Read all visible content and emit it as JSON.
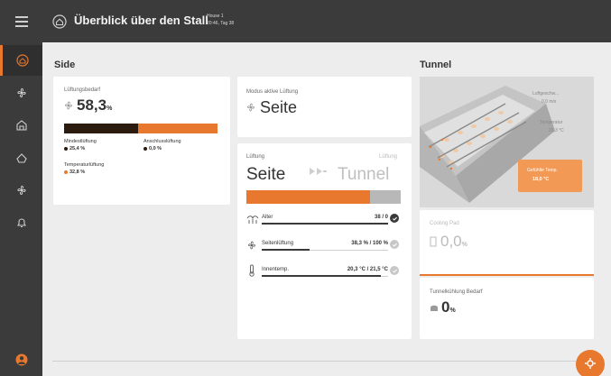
{
  "header": {
    "title": "Überblick über den Stall",
    "house_name": "House 1",
    "house_info": "20:46, Tag 38"
  },
  "sections": {
    "side": "Side",
    "tunnel": "Tunnel"
  },
  "ventilation_need": {
    "label": "Lüftungsbedarf",
    "value": "58,3",
    "unit": "%",
    "bar_dark_fraction": 0.48,
    "items": [
      {
        "label": "Mindestlüftung",
        "value": "25,4 %",
        "color": "#2b1a0e"
      },
      {
        "label": "Anschlusslüftung",
        "value": "0,0 %",
        "color": "#2b1a0e"
      },
      {
        "label": "Temperaturlüftung",
        "value": "32,8 %",
        "color": "#e8782d"
      }
    ]
  },
  "active_mode": {
    "label": "Modus aktive Lüftung",
    "value": "Seite"
  },
  "ventilation_switch": {
    "left_label": "Lüftung",
    "left_value": "Seite",
    "right_label": "Lüftung",
    "right_value": "Tunnel",
    "progress_fraction": 0.8,
    "rows": [
      {
        "icon": "age-icon",
        "label": "Alter",
        "value": "38 / 0",
        "fill": 1.0,
        "done": true
      },
      {
        "icon": "side-fan-icon",
        "label": "Seitenlüftung",
        "value": "38,3 % / 100 %",
        "fill": 0.38,
        "done": false
      },
      {
        "icon": "thermometer-icon",
        "label": "Innentemp.",
        "value": "20,3 °C / 21,5 °C",
        "fill": 0.94,
        "done": false
      }
    ]
  },
  "tunnel": {
    "info1_label": "Luftgeschw...",
    "info1_value": "0,0 m/s",
    "info2_label": "Temperatur",
    "info2_value": "20,3 °C",
    "badge_label": "Gefühlte Temp.",
    "badge_value": "18,0 °C"
  },
  "cooling": {
    "label": "Cooling Pad",
    "value": "0,0",
    "unit": "%"
  },
  "tunnel_need": {
    "label": "Tunnelkühlung Bedarf",
    "value": "0",
    "unit": "%"
  },
  "colors": {
    "accent": "#e8782d",
    "dark": "#3b3b3b",
    "bar_dark": "#2b1a0e"
  }
}
